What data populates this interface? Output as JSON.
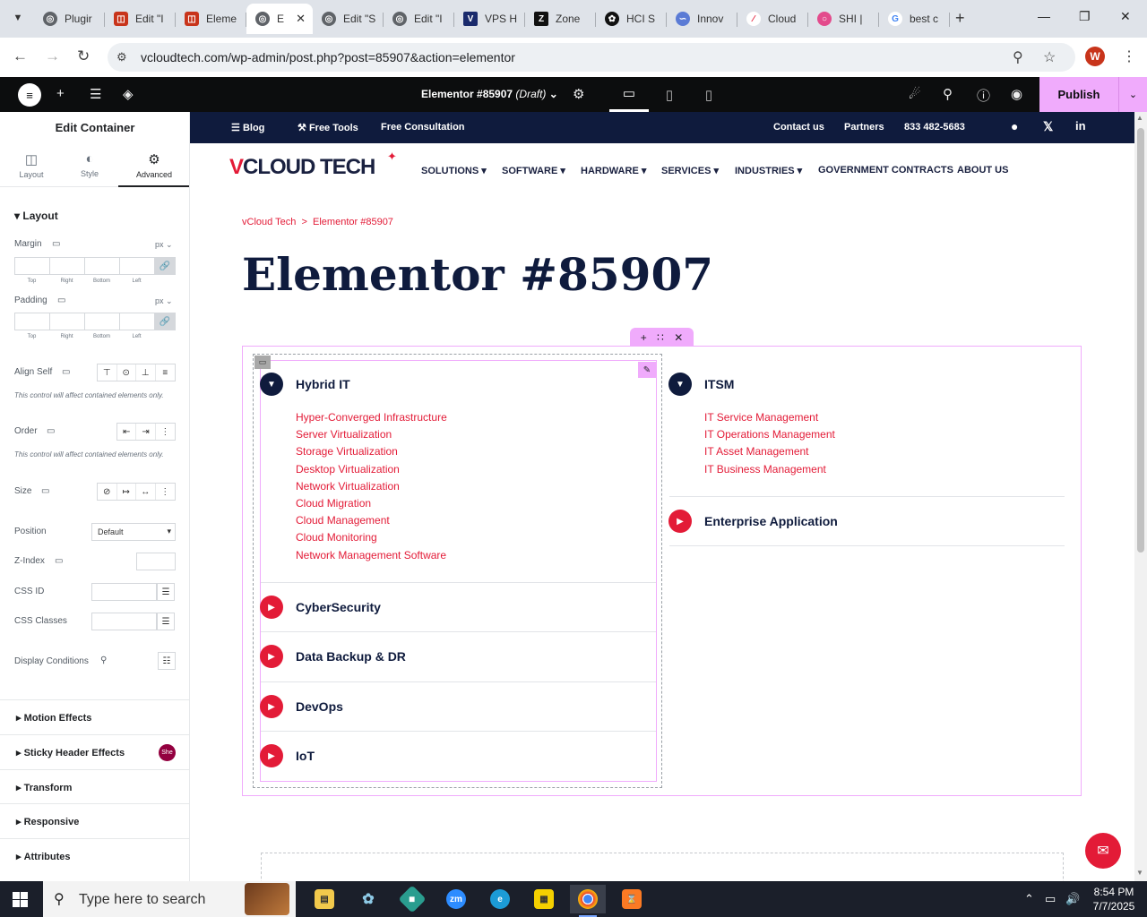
{
  "browser": {
    "tabs": [
      {
        "label": "Plugir",
        "color": "#5f6368",
        "icon": "globe-icon"
      },
      {
        "label": "Edit \"I",
        "color": "#c8341b",
        "icon": "elementor-icon"
      },
      {
        "label": "Eleme",
        "color": "#c8341b",
        "icon": "elementor-icon"
      },
      {
        "label": "E",
        "color": "#5f6368",
        "icon": "globe-icon",
        "active": true
      },
      {
        "label": "Edit \"S",
        "color": "#5f6368",
        "icon": "globe-icon"
      },
      {
        "label": "Edit \"I",
        "color": "#5f6368",
        "icon": "globe-icon"
      },
      {
        "label": "VPS H",
        "color": "#1a2a6c",
        "icon": "v-icon"
      },
      {
        "label": "Zone",
        "color": "#111111",
        "icon": "z-icon"
      },
      {
        "label": "HCI S",
        "color": "#111111",
        "icon": "openai-icon"
      },
      {
        "label": "Innov",
        "color": "#5b7bd5",
        "icon": "vmware-icon"
      },
      {
        "label": "Cloud",
        "color": "#e31b37",
        "icon": "cloud-icon"
      },
      {
        "label": "SHI |",
        "color": "#e34b8c",
        "icon": "shi-icon"
      },
      {
        "label": "best c",
        "color": "#4285f4",
        "icon": "google-icon"
      }
    ],
    "url": "vcloudtech.com/wp-admin/post.php?post=85907&action=elementor",
    "avatar_letter": "W"
  },
  "editor": {
    "doc_title": "Elementor #85907",
    "doc_status": "(Draft)",
    "publish_label": "Publish"
  },
  "panel": {
    "title": "Edit Container",
    "tabs": [
      "Layout",
      "Style",
      "Advanced"
    ],
    "layout_section": "Layout",
    "margin_label": "Margin",
    "padding_label": "Padding",
    "unit": "px",
    "sides": [
      "Top",
      "Right",
      "Bottom",
      "Left"
    ],
    "align_self_label": "Align Self",
    "note": "This control will affect contained elements only.",
    "order_label": "Order",
    "size_label": "Size",
    "position_label": "Position",
    "position_value": "Default",
    "zindex_label": "Z-Index",
    "cssid_label": "CSS ID",
    "cssclasses_label": "CSS Classes",
    "display_conditions_label": "Display Conditions",
    "sections": [
      "Motion Effects",
      "Sticky Header Effects",
      "Transform",
      "Responsive",
      "Attributes"
    ],
    "badge": "She"
  },
  "site": {
    "topbar_left": [
      "Blog",
      "Free Tools",
      "Free Consultation"
    ],
    "topbar_right": [
      "Contact us",
      "Partners",
      "833 482-5683"
    ],
    "logo_v": "V",
    "logo_rest": "CLOUD TECH",
    "menu": [
      "SOLUTIONS",
      "SOFTWARE",
      "HARDWARE",
      "SERVICES",
      "INDUSTRIES",
      "GOVERNMENT CONTRACTS",
      "ABOUT US"
    ],
    "breadcrumb_home": "vCloud Tech",
    "breadcrumb_sep": ">",
    "breadcrumb_current": "Elementor #85907",
    "page_title": "Elementor #85907",
    "left_accordion": {
      "open_title": "Hybrid IT",
      "links": [
        "Hyper-Converged Infrastructure",
        "Server Virtualization",
        "Storage Virtualization",
        "Desktop Virtualization",
        "Network Virtualization",
        "Cloud Migration",
        "Cloud Management",
        "Cloud Monitoring",
        "Network Management Software"
      ],
      "closed": [
        "CyberSecurity",
        "Data Backup & DR",
        "DevOps",
        "IoT"
      ]
    },
    "right_accordion": {
      "open_title": "ITSM",
      "links": [
        "IT Service Management",
        "IT Operations Management",
        "IT Asset Management",
        "IT Business Management"
      ],
      "closed": [
        "Enterprise Application"
      ]
    }
  },
  "taskbar": {
    "search_placeholder": "Type here to search",
    "time": "8:54 PM",
    "date": "7/7/2025"
  }
}
